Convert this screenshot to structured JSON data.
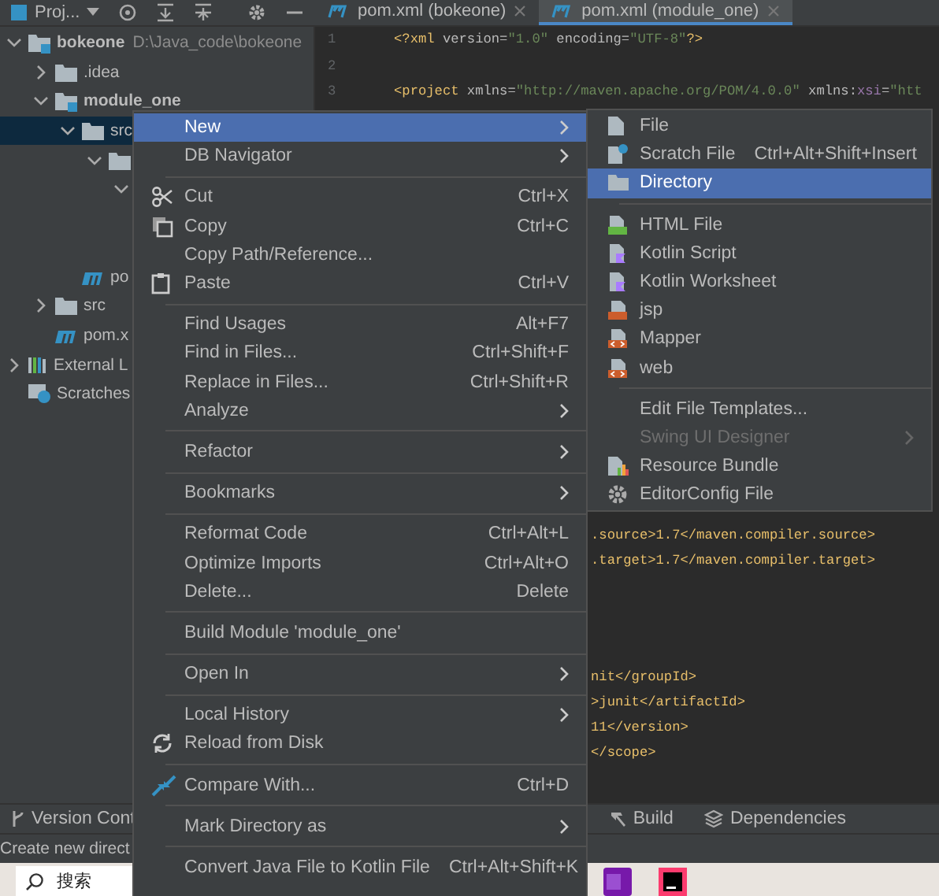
{
  "toolbar": {
    "project_label": "Proj..."
  },
  "tabs": [
    {
      "label": "pom.xml (bokeone)",
      "selected": false
    },
    {
      "label": "pom.xml (module_one)",
      "selected": true
    }
  ],
  "tree": [
    {
      "label": "bokeone",
      "path": "D:\\Java_code\\bokeone",
      "kind": "module",
      "expanded": true,
      "selected": false,
      "children": [
        {
          "label": ".idea",
          "kind": "folder",
          "expanded": false,
          "selected": false
        },
        {
          "label": "module_one",
          "kind": "module",
          "expanded": true,
          "selected": false,
          "children": [
            {
              "label": "src",
              "kind": "folder",
              "expanded": true,
              "selected": true,
              "children": [
                {
                  "kind": "folder",
                  "expanded": true,
                  "selected": false,
                  "children": [
                    {
                      "expanded": true,
                      "selected": false
                    }
                  ]
                }
              ]
            },
            {
              "label": "po",
              "kind": "maven",
              "selected": false
            }
          ]
        },
        {
          "label": "src",
          "kind": "folder",
          "expanded": false,
          "selected": false
        },
        {
          "label": "pom.x",
          "kind": "maven",
          "selected": false
        }
      ]
    },
    {
      "label": "External L",
      "kind": "library",
      "expanded": false,
      "selected": false
    },
    {
      "label": "Scratches",
      "kind": "scratches",
      "selected": false
    }
  ],
  "editor": {
    "lines": [
      {
        "number": "1",
        "segments": [
          {
            "text": "<?xml",
            "kind": "tag"
          },
          {
            "text": " version=",
            "kind": "attr"
          },
          {
            "text": "\"1.0\"",
            "kind": "value"
          },
          {
            "text": " encoding=",
            "kind": "attr"
          },
          {
            "text": "\"UTF-8\"",
            "kind": "value"
          },
          {
            "text": "?>",
            "kind": "tag"
          }
        ]
      },
      {
        "number": "2"
      },
      {
        "number": "3",
        "segments": [
          {
            "text": "<project",
            "kind": "tag"
          },
          {
            "text": " xmlns=",
            "kind": "attr"
          },
          {
            "text": "\"http://maven.apache.org/POM/4.0.0\"",
            "kind": "value"
          },
          {
            "text": " xmlns:",
            "kind": "attr"
          },
          {
            "text": "xsi",
            "kind": "ns"
          },
          {
            "text": "=",
            "kind": "attr"
          },
          {
            "text": "\"htt",
            "kind": "value"
          }
        ]
      }
    ],
    "tail_groups": [
      [
        ".source>1.7</maven.compiler.source>",
        ".target>1.7</maven.compiler.target>"
      ],
      [
        "nit</groupId>",
        ">junit</artifactId>",
        "11</version>",
        "</scope>"
      ]
    ]
  },
  "context_menu": {
    "items": [
      {
        "kind": "item",
        "label": "New",
        "has_submenu": true,
        "selected": true
      },
      {
        "kind": "item",
        "label": "DB Navigator",
        "has_submenu": true,
        "selected": false
      },
      {
        "kind": "separator"
      },
      {
        "kind": "item",
        "label": "Cut",
        "shortcut": "Ctrl+X",
        "has_submenu": false,
        "selected": false
      },
      {
        "kind": "item",
        "label": "Copy",
        "shortcut": "Ctrl+C",
        "has_submenu": false,
        "selected": false
      },
      {
        "kind": "item",
        "label": "Copy Path/Reference...",
        "has_submenu": false,
        "selected": false
      },
      {
        "kind": "item",
        "label": "Paste",
        "shortcut": "Ctrl+V",
        "has_submenu": false,
        "selected": false
      },
      {
        "kind": "separator"
      },
      {
        "kind": "item",
        "label": "Find Usages",
        "shortcut": "Alt+F7",
        "has_submenu": false,
        "selected": false
      },
      {
        "kind": "item",
        "label": "Find in Files...",
        "shortcut": "Ctrl+Shift+F",
        "has_submenu": false,
        "selected": false
      },
      {
        "kind": "item",
        "label": "Replace in Files...",
        "shortcut": "Ctrl+Shift+R",
        "has_submenu": false,
        "selected": false
      },
      {
        "kind": "item",
        "label": "Analyze",
        "has_submenu": true,
        "selected": false
      },
      {
        "kind": "separator"
      },
      {
        "kind": "item",
        "label": "Refactor",
        "has_submenu": true,
        "selected": false
      },
      {
        "kind": "separator"
      },
      {
        "kind": "item",
        "label": "Bookmarks",
        "has_submenu": true,
        "selected": false
      },
      {
        "kind": "separator"
      },
      {
        "kind": "item",
        "label": "Reformat Code",
        "shortcut": "Ctrl+Alt+L",
        "has_submenu": false,
        "selected": false
      },
      {
        "kind": "item",
        "label": "Optimize Imports",
        "shortcut": "Ctrl+Alt+O",
        "has_submenu": false,
        "selected": false
      },
      {
        "kind": "item",
        "label": "Delete...",
        "shortcut": "Delete",
        "has_submenu": false,
        "selected": false
      },
      {
        "kind": "separator"
      },
      {
        "kind": "item",
        "label": "Build Module 'module_one'",
        "has_submenu": false,
        "selected": false
      },
      {
        "kind": "separator"
      },
      {
        "kind": "item",
        "label": "Open In",
        "has_submenu": true,
        "selected": false
      },
      {
        "kind": "separator"
      },
      {
        "kind": "item",
        "label": "Local History",
        "has_submenu": true,
        "selected": false
      },
      {
        "kind": "item",
        "label": "Reload from Disk",
        "has_submenu": false,
        "selected": false
      },
      {
        "kind": "separator"
      },
      {
        "kind": "item",
        "label": "Compare With...",
        "shortcut": "Ctrl+D",
        "has_submenu": false,
        "selected": false
      },
      {
        "kind": "separator"
      },
      {
        "kind": "item",
        "label": "Mark Directory as",
        "has_submenu": true,
        "selected": false
      },
      {
        "kind": "separator"
      },
      {
        "kind": "item",
        "label": "Convert Java File to Kotlin File",
        "shortcut": "Ctrl+Alt+Shift+K",
        "has_submenu": false,
        "selected": false
      }
    ]
  },
  "new_submenu": {
    "items": [
      {
        "kind": "item",
        "label": "File",
        "has_submenu": false,
        "selected": false,
        "disabled": false
      },
      {
        "kind": "item",
        "label": "Scratch File",
        "shortcut": "Ctrl+Alt+Shift+Insert",
        "has_submenu": false,
        "selected": false,
        "disabled": false
      },
      {
        "kind": "item",
        "label": "Directory",
        "has_submenu": false,
        "selected": true,
        "disabled": false
      },
      {
        "kind": "separator"
      },
      {
        "kind": "item",
        "label": "HTML File",
        "has_submenu": false,
        "selected": false,
        "disabled": false
      },
      {
        "kind": "item",
        "label": "Kotlin Script",
        "has_submenu": false,
        "selected": false,
        "disabled": false
      },
      {
        "kind": "item",
        "label": "Kotlin Worksheet",
        "has_submenu": false,
        "selected": false,
        "disabled": false
      },
      {
        "kind": "item",
        "label": "jsp",
        "has_submenu": false,
        "selected": false,
        "disabled": false
      },
      {
        "kind": "item",
        "label": "Mapper",
        "has_submenu": false,
        "selected": false,
        "disabled": false
      },
      {
        "kind": "item",
        "label": "web",
        "has_submenu": false,
        "selected": false,
        "disabled": false
      },
      {
        "kind": "separator"
      },
      {
        "kind": "item",
        "label": "Edit File Templates...",
        "has_submenu": false,
        "selected": false,
        "disabled": false
      },
      {
        "kind": "item",
        "label": "Swing UI Designer",
        "has_submenu": true,
        "selected": false,
        "disabled": true
      },
      {
        "kind": "item",
        "label": "Resource Bundle",
        "has_submenu": false,
        "selected": false,
        "disabled": false
      },
      {
        "kind": "item",
        "label": "EditorConfig File",
        "has_submenu": false,
        "selected": false,
        "disabled": false
      }
    ]
  },
  "tool_tabs": [
    {
      "label": "Version Cont"
    },
    {
      "label": "Build"
    },
    {
      "label": "Dependencies"
    }
  ],
  "status_bar": {
    "text": "Create new direct"
  },
  "taskbar": {
    "search_placeholder": "搜索"
  }
}
